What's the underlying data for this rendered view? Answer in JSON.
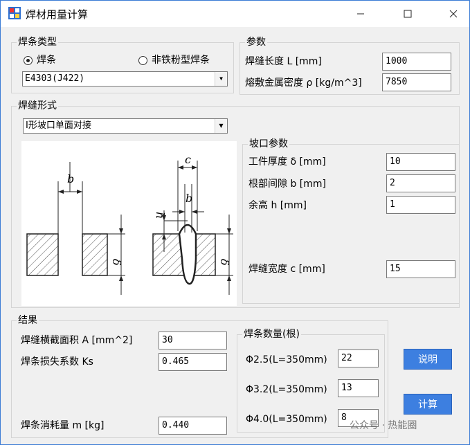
{
  "window": {
    "title": "焊材用量计算"
  },
  "rod_type": {
    "title": "焊条类型",
    "option_rod": "焊条",
    "option_powder": "非铁粉型焊条",
    "selected_model": "E4303(J422)"
  },
  "params": {
    "title": "参数",
    "length_label": "焊缝长度 L  [mm]",
    "length_value": "1000",
    "density_label": "熔敷金属密度 ρ  [kg/m^3]",
    "density_value": "7850"
  },
  "weld_form": {
    "title": "焊缝形式",
    "selected": "I形坡口单面对接"
  },
  "groove": {
    "title": "坡口参数",
    "thickness_label": "工件厚度 δ  [mm]",
    "thickness_value": "10",
    "gap_label": "根部间隙 b  [mm]",
    "gap_value": "2",
    "reinforcement_label": "余高 h  [mm]",
    "reinforcement_value": "1",
    "width_label": "焊缝宽度 c  [mm]",
    "width_value": "15"
  },
  "diagram": {
    "label_b": "b",
    "label_c": "c",
    "label_h": "h",
    "label_delta": "δ"
  },
  "result": {
    "title": "结果",
    "area_label": "焊缝横截面积 A  [mm^2]",
    "area_value": "30",
    "loss_label": "焊条损失系数 Ks",
    "loss_value": "0.465",
    "consumption_label": "焊条消耗量 m  [kg]",
    "consumption_value": "0.440"
  },
  "rod_count": {
    "title": "焊条数量(根)",
    "d25_label": "Φ2.5(L=350mm)",
    "d25_value": "22",
    "d32_label": "Φ3.2(L=350mm)",
    "d32_value": "13",
    "d40_label": "Φ4.0(L=350mm)",
    "d40_value": "8"
  },
  "buttons": {
    "help": "说明",
    "calc": "计算"
  },
  "watermark": "公众号 · 热能圈"
}
